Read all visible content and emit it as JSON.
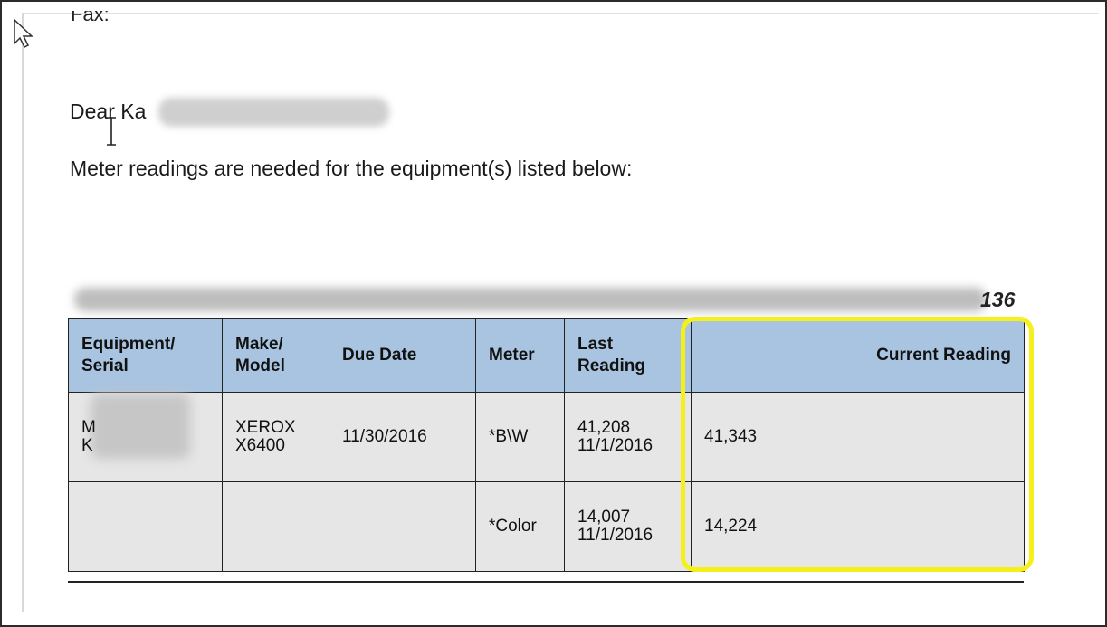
{
  "document": {
    "fax_label": "Fax:",
    "greeting": "Dear Ka",
    "intro": "Meter readings are needed for the equipment(s) listed below:",
    "header_number": "136"
  },
  "table": {
    "headers": [
      "Equipment/ Serial",
      "Make/ Model",
      "Due Date",
      "Meter",
      "Last Reading",
      "Current Reading"
    ],
    "rows": [
      {
        "equipment_serial": [
          "M",
          "K"
        ],
        "make_model": [
          "XEROX",
          "X6400"
        ],
        "due_date": "11/30/2016",
        "meter": "*B\\W",
        "last_reading": [
          "41,208",
          "11/1/2016"
        ],
        "current_reading": "41,343"
      },
      {
        "equipment_serial": [
          "",
          ""
        ],
        "make_model": [
          "",
          ""
        ],
        "due_date": "",
        "meter": "*Color",
        "last_reading": [
          "14,007",
          "11/1/2016"
        ],
        "current_reading": "14,224"
      }
    ]
  },
  "colors": {
    "header_bg": "#a9c4e0",
    "cell_bg": "#e6e6e6",
    "link_text": "#2f5b9a",
    "highlight": "#f5f01a"
  },
  "icons": [
    "mouse-pointer-icon",
    "text-cursor-icon"
  ]
}
